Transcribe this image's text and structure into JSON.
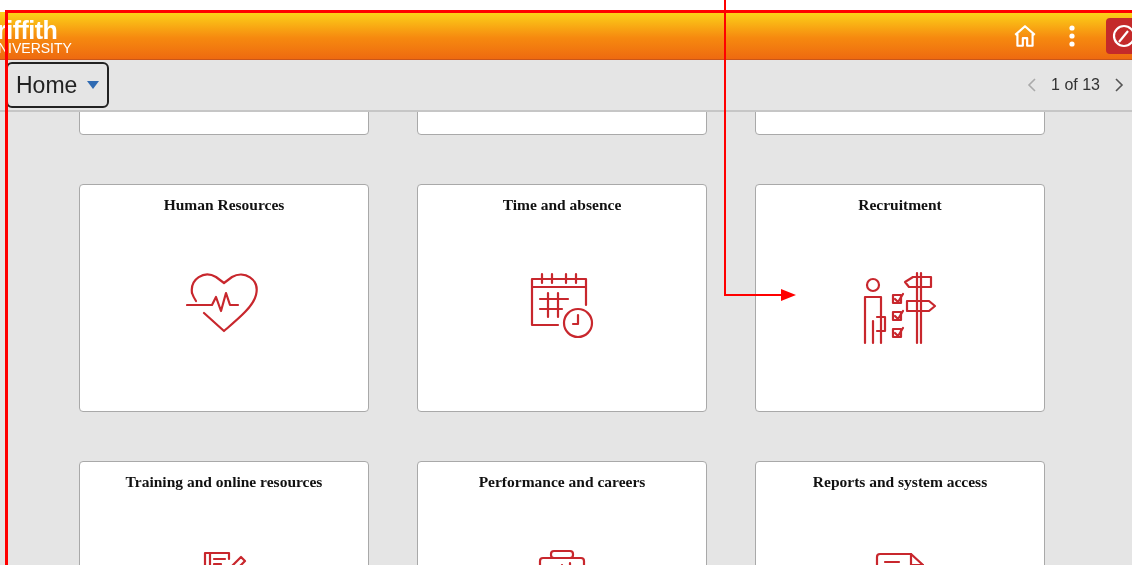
{
  "header": {
    "logo_main": "riffith",
    "logo_sub": "NIVERSITY"
  },
  "toolbar": {
    "page_title": "Home",
    "pager": "1 of 13"
  },
  "tiles": [
    {
      "kind": "cut"
    },
    {
      "kind": "cut"
    },
    {
      "kind": "cut"
    },
    {
      "kind": "tile",
      "title": "Human Resources"
    },
    {
      "kind": "tile",
      "title": "Time and absence"
    },
    {
      "kind": "tile",
      "title": "Recruitment"
    },
    {
      "kind": "tile",
      "title": "Training and online resources"
    },
    {
      "kind": "tile",
      "title": "Performance and careers"
    },
    {
      "kind": "tile",
      "title": "Reports and system access"
    }
  ]
}
